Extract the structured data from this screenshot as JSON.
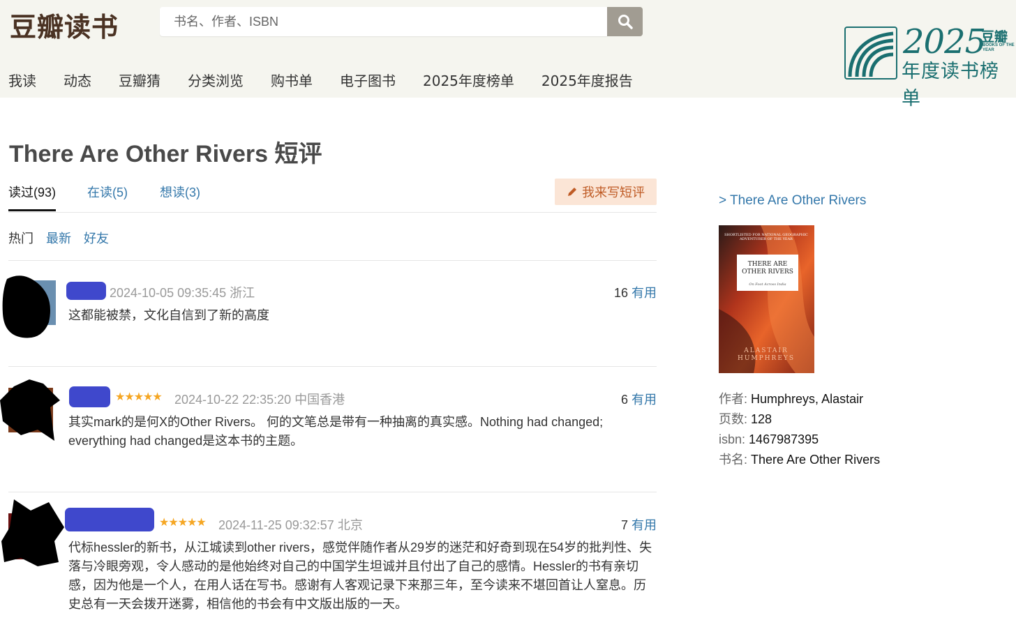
{
  "header": {
    "logo": "豆瓣读书",
    "search": {
      "placeholder": "书名、作者、ISBN",
      "value": ""
    },
    "nav": [
      "我读",
      "动态",
      "豆瓣猜",
      "分类浏览",
      "购书单",
      "电子图书",
      "2025年度榜单",
      "2025年度报告"
    ],
    "promo": {
      "year": "2025",
      "brand": "豆瓣",
      "tagline_en": "BOOKS OF THE YEAR",
      "subtitle": "年度读书榜单"
    }
  },
  "page_title": "There Are Other Rivers 短评",
  "tabs": [
    {
      "label": "读过(93)",
      "active": true
    },
    {
      "label": "在读(5)",
      "active": false
    },
    {
      "label": "想读(3)",
      "active": false
    }
  ],
  "write_button": "我来写短评",
  "sorts": [
    "热门",
    "最新",
    "好友"
  ],
  "comments": [
    {
      "stars": "",
      "time": "2024-10-05 09:35:45",
      "location": "浙江",
      "votes": "16",
      "useful_label": "有用",
      "text": "这都能被禁，文化自信到了新的高度"
    },
    {
      "stars": "★★★★★",
      "time": "2024-10-22 22:35:20",
      "location": "中国香港",
      "votes": "6",
      "useful_label": "有用",
      "text": "其实mark的是何X的Other Rivers。 何的文笔总是带有一种抽离的真实感。Nothing had changed; everything had changed是这本书的主题。"
    },
    {
      "stars": "★★★★★",
      "time": "2024-11-25 09:32:57",
      "location": "北京",
      "votes": "7",
      "useful_label": "有用",
      "text": "代标hessler的新书，从江城读到other rivers，感觉伴随作者从29岁的迷茫和好奇到现在54岁的批判性、失落与冷眼旁观，令人感动的是他始终对自己的中国学生坦诚并且付出了自己的感情。Hessler的书有亲切感，因为他是一个人，在用人话在写书。感谢有人客观记录下来那三年，至今读来不堪回首让人窒息。历史总有一天会拨开迷雾，相信他的书会有中文版出版的一天。"
    }
  ],
  "aside": {
    "book_link": "> There Are Other Rivers",
    "cover": {
      "shortlist": "SHORTLISTED FOR NATIONAL GEOGRAPHIC ADVENTURER OF THE YEAR",
      "title": "There Are Other Rivers",
      "subtitle": "On Foot Across India",
      "author": "ALASTAIR HUMPHREYS"
    },
    "info": [
      {
        "key": "作者:",
        "value": "Humphreys, Alastair"
      },
      {
        "key": "页数:",
        "value": "128"
      },
      {
        "key": "isbn:",
        "value": "1467987395"
      },
      {
        "key": "书名:",
        "value": "There Are Other Rivers"
      }
    ]
  },
  "colors": {
    "link": "#3377aa",
    "header_bg": "#f5f5ef",
    "accent_teal": "#1a6f70",
    "star": "#f5a623",
    "redaction_blue": "#3f48cc"
  }
}
